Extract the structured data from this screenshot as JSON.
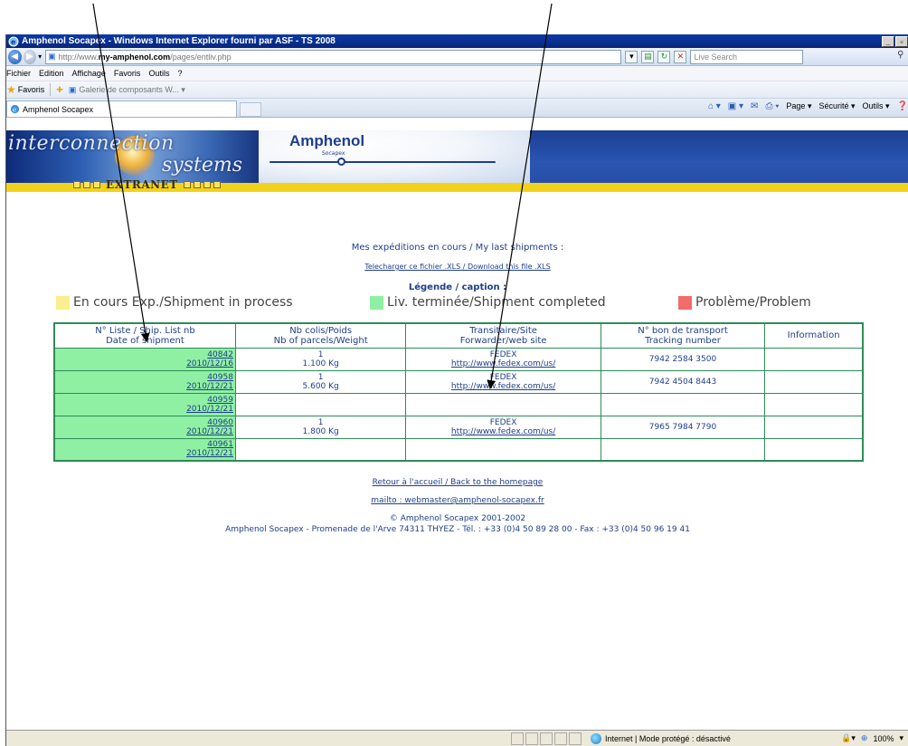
{
  "window": {
    "title": "Amphenol Socapex - Windows Internet Explorer fourni par ASF - TS 2008",
    "min_btn": "_",
    "max_btn": "▫"
  },
  "address": {
    "url_prefix": "http://www.",
    "url_host": "my-amphenol.com",
    "url_path": "/pages/entliv.php",
    "search_placeholder": "Live Search"
  },
  "menu": [
    "Fichier",
    "Edition",
    "Affichage",
    "Favoris",
    "Outils",
    "?"
  ],
  "favorites": {
    "label": "Favoris",
    "gallery": "Galerie de composants W... ▾"
  },
  "tab": {
    "label": "Amphenol Socapex"
  },
  "commands": [
    "Page ▾",
    "Sécurité ▾",
    "Outils ▾"
  ],
  "banner": {
    "ic_line1": "interconnection",
    "ic_line2": "systems",
    "brand": "Amphenol",
    "brand_sub": "Socapex",
    "extranet": "EXTRANET"
  },
  "page": {
    "heading": "Mes expéditions en cours / My last shipments :",
    "download_link": "Telecharger ce fichier .XLS / Download this file .XLS",
    "legend_caption": "Légende / caption :"
  },
  "legend": [
    {
      "label": "En cours Exp./Shipment in process",
      "color": "#fbee8d"
    },
    {
      "label": "Liv. terminée/Shipment completed",
      "color": "#8ff0a3"
    },
    {
      "label": "Problème/Problem",
      "color": "#f26c6c"
    }
  ],
  "table": {
    "headers": [
      [
        "N° Liste / Ship. List nb",
        "Date of shipment"
      ],
      [
        "Nb colis/Poids",
        "Nb of parcels/Weight"
      ],
      [
        "Transitaire/Site",
        "Forwarder/web site"
      ],
      [
        "N° bon de transport",
        "Tracking number"
      ],
      [
        "Information"
      ]
    ],
    "rows": [
      {
        "list_nb": "40842",
        "date": "2010/12/16",
        "parcels": "1",
        "weight": "1.100 Kg",
        "forwarder": "FEDEX",
        "site": "http://www.fedex.com/us/",
        "tracking": "7942 2584 3500",
        "info": ""
      },
      {
        "list_nb": "40958",
        "date": "2010/12/21",
        "parcels": "1",
        "weight": "5.600 Kg",
        "forwarder": "FEDEX",
        "site": "http://www.fedex.com/us/",
        "tracking": "7942 4504 8443",
        "info": ""
      },
      {
        "list_nb": "40959",
        "date": "2010/12/21",
        "parcels": "",
        "weight": "",
        "forwarder": "",
        "site": "",
        "tracking": "",
        "info": ""
      },
      {
        "list_nb": "40960",
        "date": "2010/12/21",
        "parcels": "1",
        "weight": "1.800 Kg",
        "forwarder": "FEDEX",
        "site": "http://www.fedex.com/us/",
        "tracking": "7965 7984 7790",
        "info": ""
      },
      {
        "list_nb": "40961",
        "date": "2010/12/21",
        "parcels": "",
        "weight": "",
        "forwarder": "",
        "site": "",
        "tracking": "",
        "info": ""
      }
    ]
  },
  "footer": {
    "back_link": "Retour à l'accueil / Back to the homepage",
    "mail_link": "mailto : webmaster@amphenol-socapex.fr",
    "copyright": "© Amphenol Socapex 2001-2002",
    "address": "Amphenol Socapex - Promenade de l'Arve 74311 THYEZ - Tél. : +33 (0)4 50 89 28 00 - Fax : +33 (0)4 50 96 19 41"
  },
  "status": {
    "zone": "Internet | Mode protégé : désactivé",
    "zoom": "100%"
  }
}
